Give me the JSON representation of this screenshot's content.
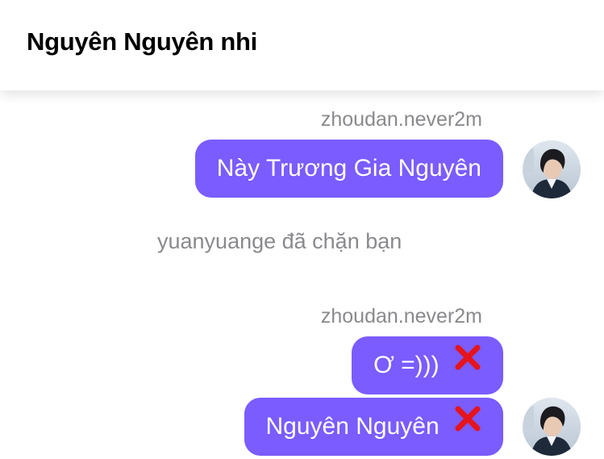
{
  "header": {
    "title": "Nguyên Nguyên nhi"
  },
  "messages": [
    {
      "sender": "zhoudan.never2m",
      "text": "Này Trương Gia Nguyên"
    },
    {
      "system": "yuanyuange đã chặn bạn"
    },
    {
      "sender": "zhoudan.never2m",
      "text": "Ơ =)))"
    },
    {
      "text": "Nguyên Nguyên"
    }
  ],
  "icons": {
    "failed": "cross-mark-icon",
    "avatar": "user-avatar"
  },
  "colors": {
    "bubble": "#7a5cff",
    "meta_text": "#8a8a8e",
    "failed_mark": "#e5141d"
  }
}
